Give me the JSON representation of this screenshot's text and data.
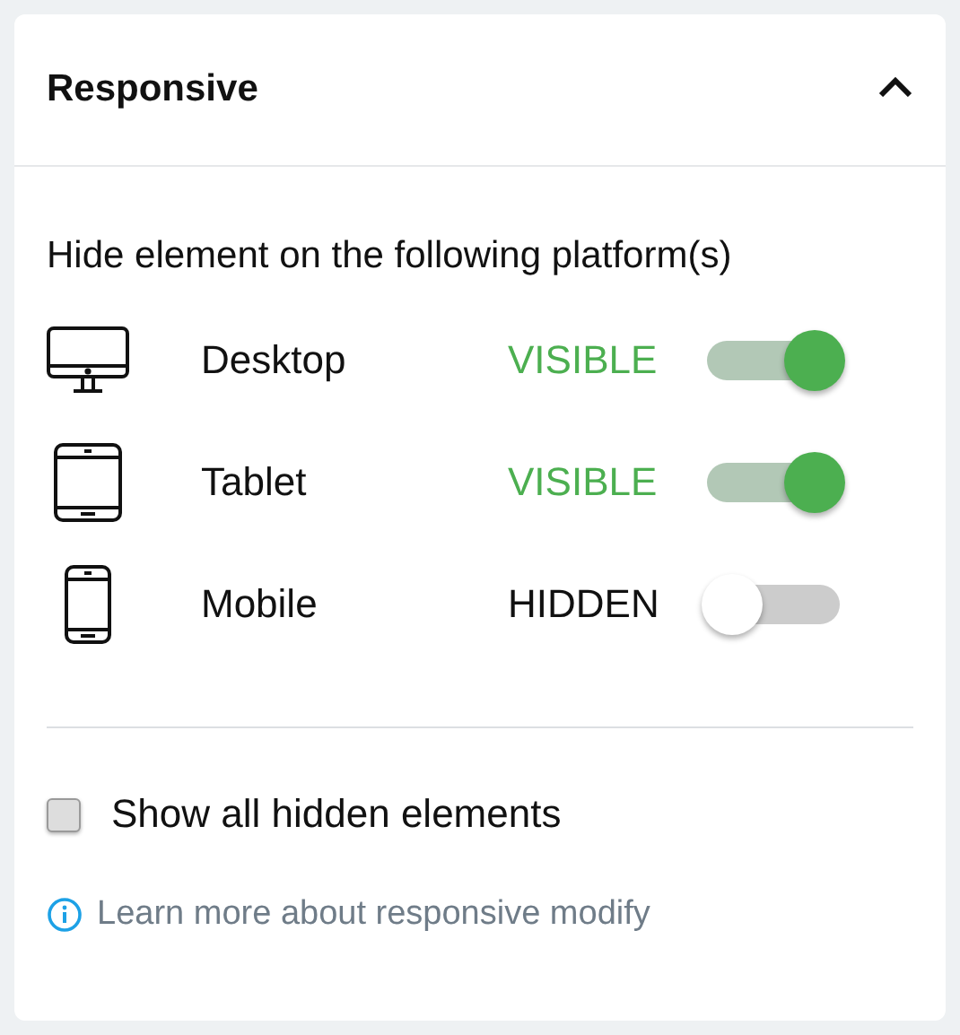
{
  "panel": {
    "title": "Responsive",
    "expanded": true
  },
  "intro": "Hide element on the following platform(s)",
  "platforms": [
    {
      "kind": "desktop",
      "name": "Desktop",
      "status": "VISIBLE",
      "on": true
    },
    {
      "kind": "tablet",
      "name": "Tablet",
      "status": "VISIBLE",
      "on": true
    },
    {
      "kind": "mobile",
      "name": "Mobile",
      "status": "HIDDEN",
      "on": false
    }
  ],
  "show_hidden": {
    "label": "Show all hidden elements",
    "checked": false
  },
  "help_link": "Learn more about responsive modify"
}
